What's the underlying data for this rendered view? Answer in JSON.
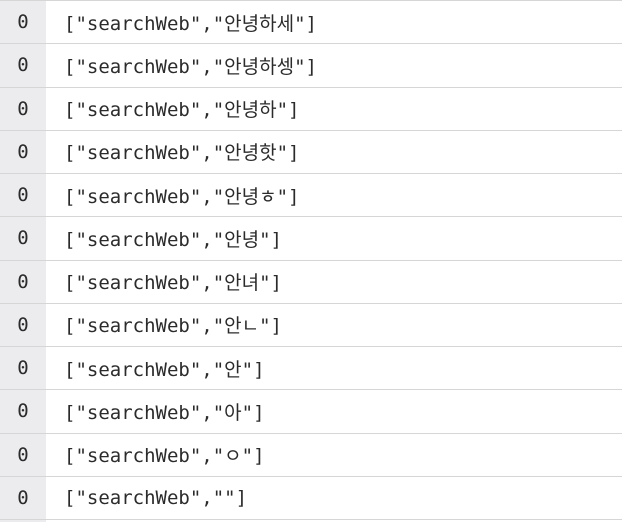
{
  "rows": [
    {
      "count": "0",
      "value": "[\"searchWeb\",\"안녕하세\"]"
    },
    {
      "count": "0",
      "value": "[\"searchWeb\",\"안녕하셍\"]"
    },
    {
      "count": "0",
      "value": "[\"searchWeb\",\"안녕하\"]"
    },
    {
      "count": "0",
      "value": "[\"searchWeb\",\"안녕핫\"]"
    },
    {
      "count": "0",
      "value": "[\"searchWeb\",\"안녕ㅎ\"]"
    },
    {
      "count": "0",
      "value": "[\"searchWeb\",\"안녕\"]"
    },
    {
      "count": "0",
      "value": "[\"searchWeb\",\"안녀\"]"
    },
    {
      "count": "0",
      "value": "[\"searchWeb\",\"안ㄴ\"]"
    },
    {
      "count": "0",
      "value": "[\"searchWeb\",\"안\"]"
    },
    {
      "count": "0",
      "value": "[\"searchWeb\",\"아\"]"
    },
    {
      "count": "0",
      "value": "[\"searchWeb\",\"ㅇ\"]"
    },
    {
      "count": "0",
      "value": "[\"searchWeb\",\"\"]"
    }
  ]
}
